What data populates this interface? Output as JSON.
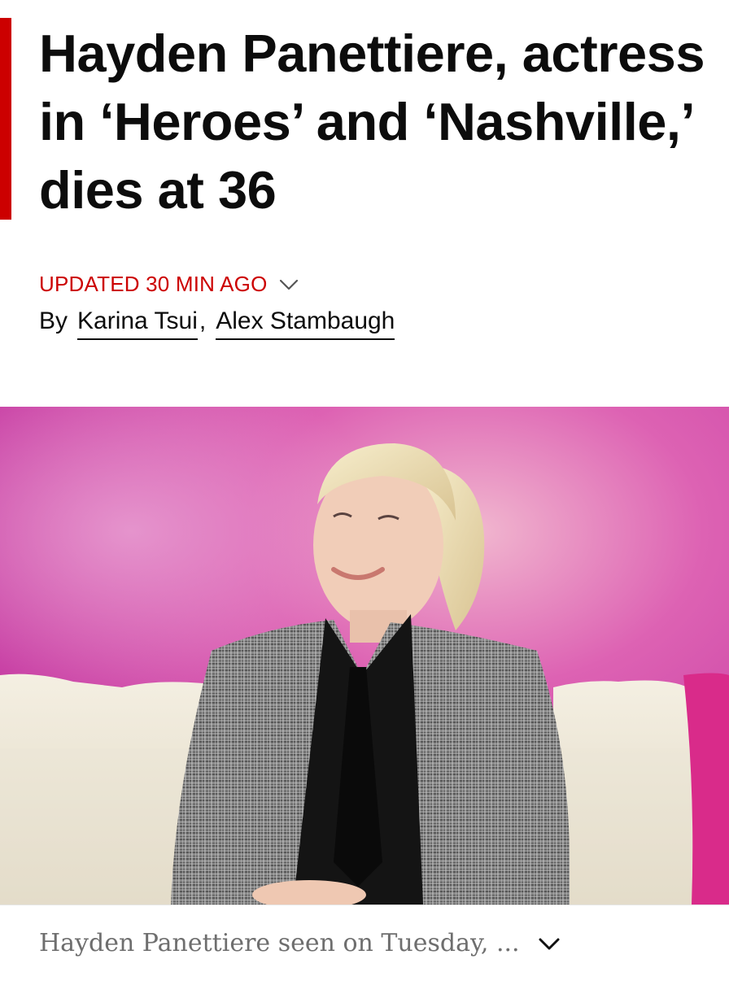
{
  "article": {
    "headline": "Hayden Panettiere, actress in ‘Heroes’ and ‘Nashville,’ dies at 36",
    "updated_label": "UPDATED 30 MIN AGO",
    "byline_prefix": "By",
    "authors": [
      "Karina Tsui",
      "Alex Stambaugh"
    ],
    "author_separator": ","
  },
  "hero_image": {
    "caption": "Hayden Panettiere seen on Tuesday, ..."
  },
  "colors": {
    "accent": "#cc0000",
    "text": "#0c0c0c",
    "caption": "#6e6e6e"
  },
  "icons": {
    "updated_toggle": "chevron-down-icon",
    "caption_toggle": "chevron-down-icon"
  }
}
